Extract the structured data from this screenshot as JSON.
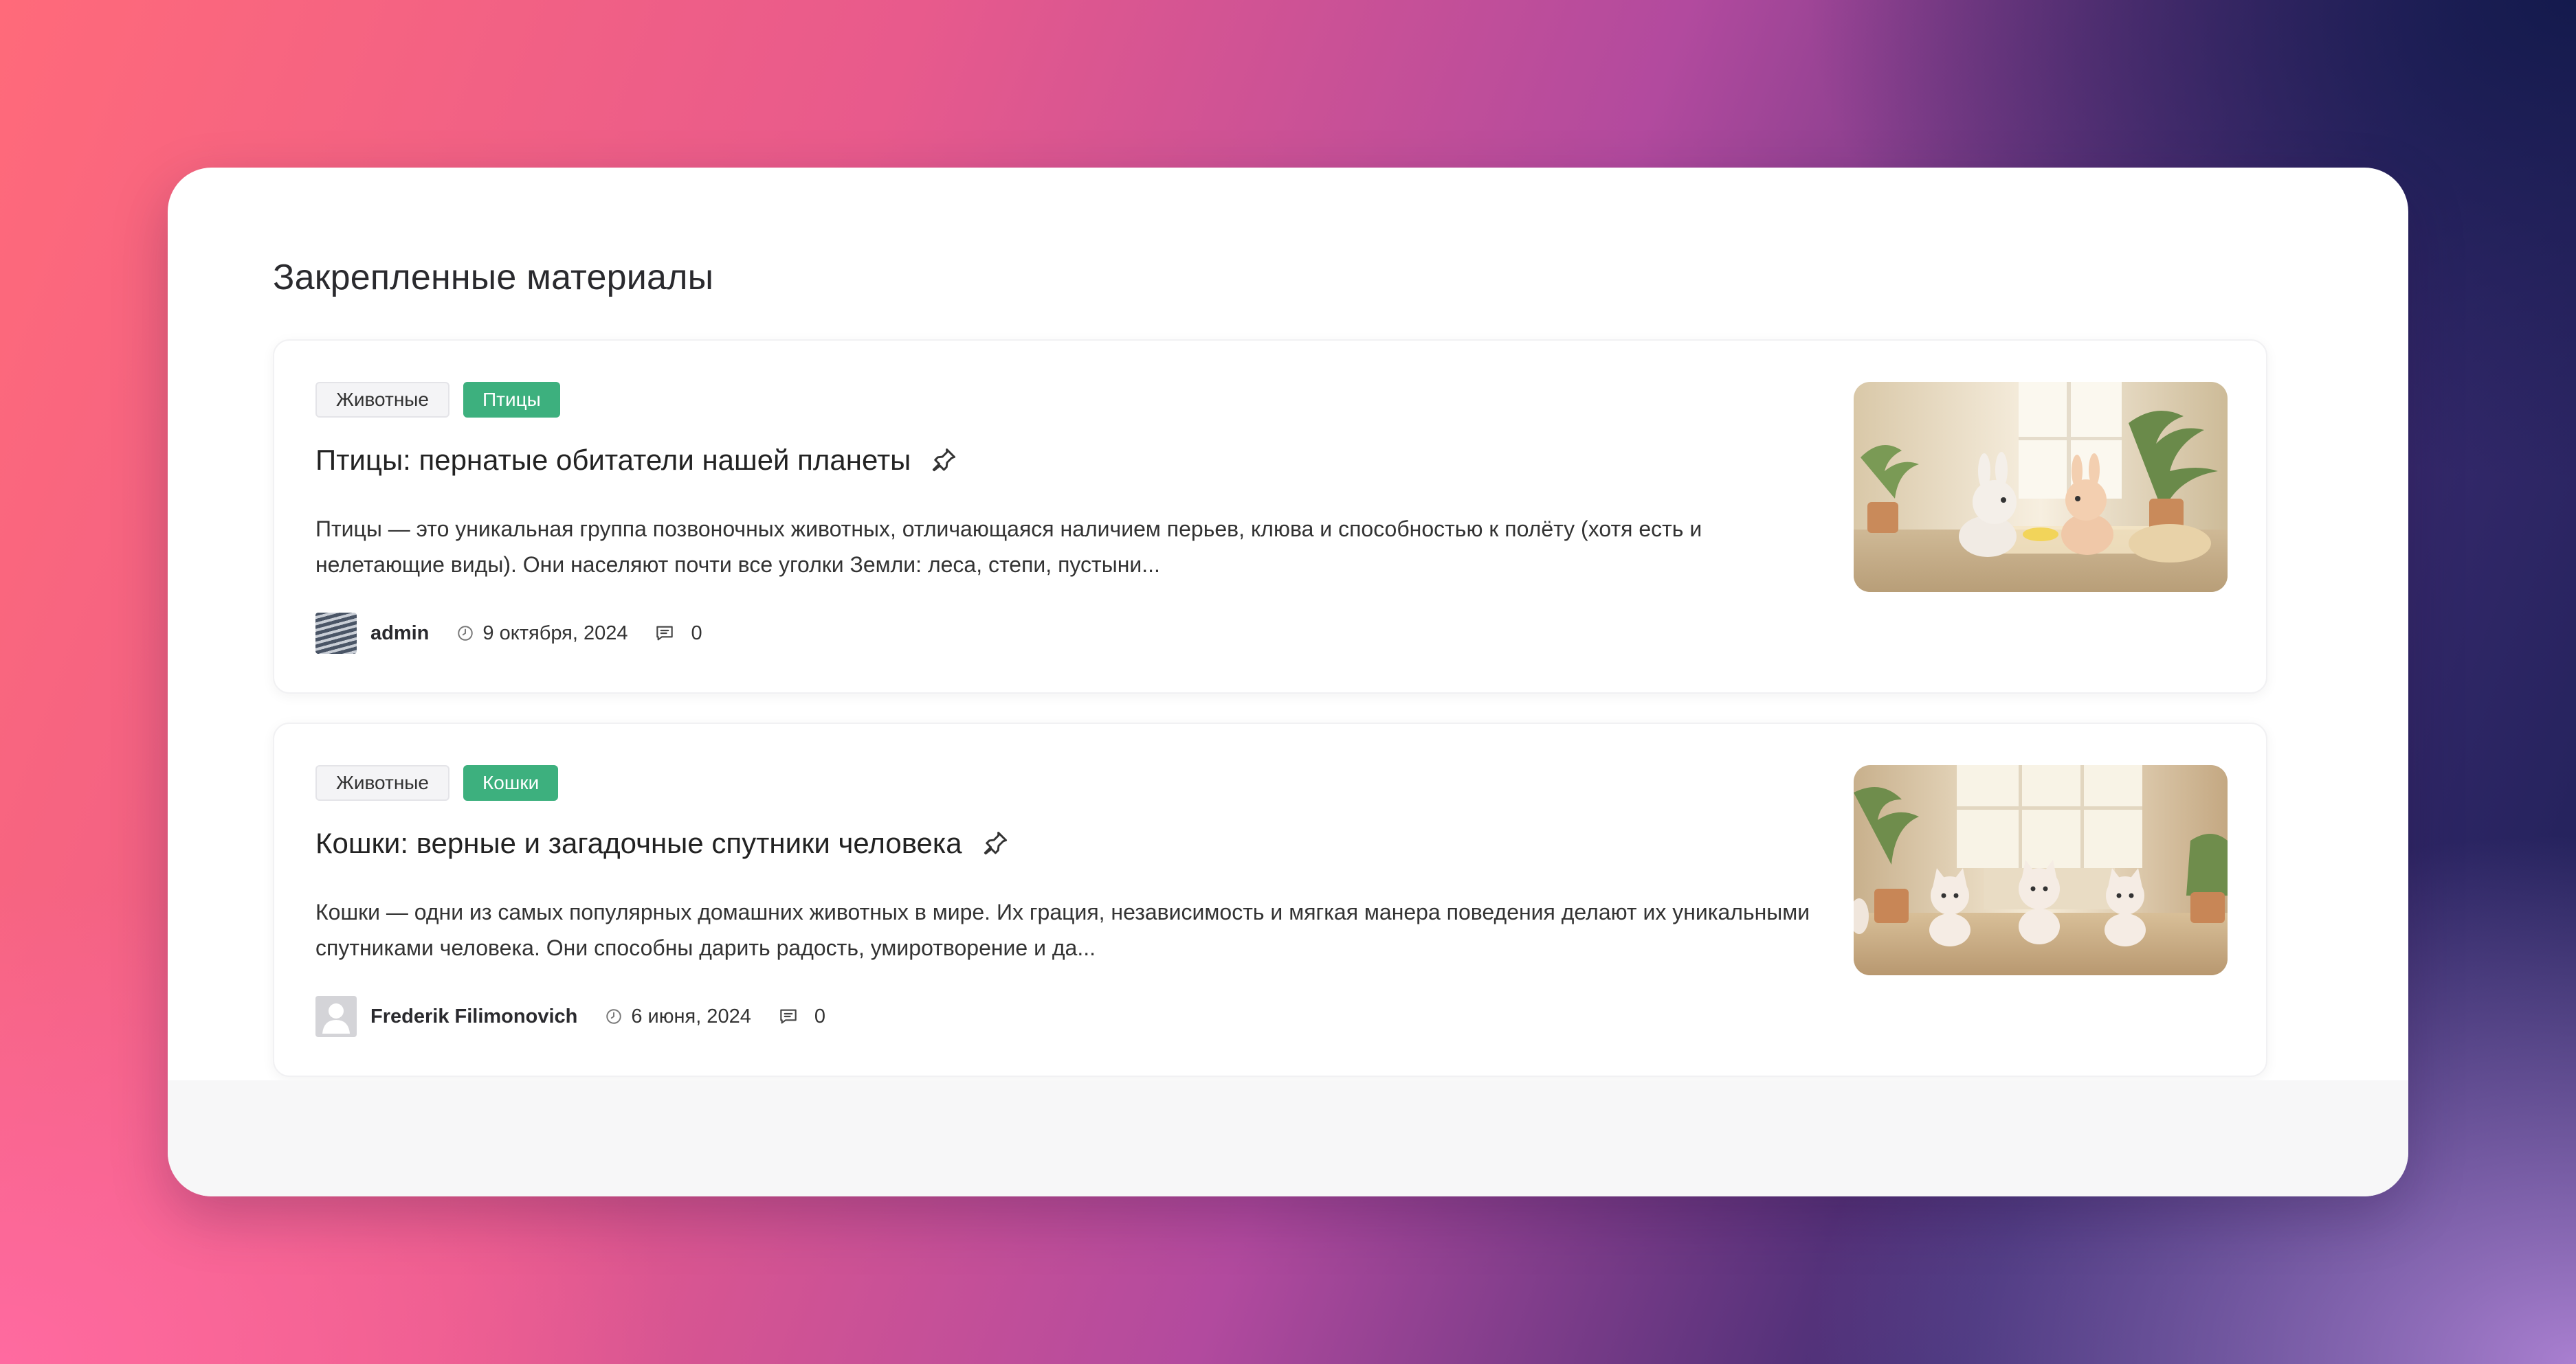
{
  "section": {
    "title": "Закрепленные материалы"
  },
  "posts": [
    {
      "tags": [
        "Животные",
        "Птицы"
      ],
      "title": "Птицы: пернатые обитатели нашей планеты",
      "excerpt": "Птицы — это уникальная группа позвоночных животных, отличающаяся наличием перьев, клюва и способностью к полёту (хотя есть и нелетающие виды). Они населяют почти все уголки Земли: леса, степи, пустыни...",
      "author": "admin",
      "date": "9 октября, 2024",
      "comments": "0"
    },
    {
      "tags": [
        "Животные",
        "Кошки"
      ],
      "title": "Кошки: верные и загадочные спутники человека",
      "excerpt": "Кошки — одни из самых популярных домашних животных в мире. Их грация, независимость и мягкая манера поведения делают их уникальными спутниками человека. Они способны дарить радость, умиротворение и да...",
      "author": "Frederik Filimonovich",
      "date": "6 июня, 2024",
      "comments": "0"
    }
  ],
  "colors": {
    "accent_tag": "#3db07e",
    "card_bg": "#ffffff"
  },
  "icons": {
    "pin": "pin-icon",
    "clock": "clock-icon",
    "comment": "comment-icon"
  }
}
